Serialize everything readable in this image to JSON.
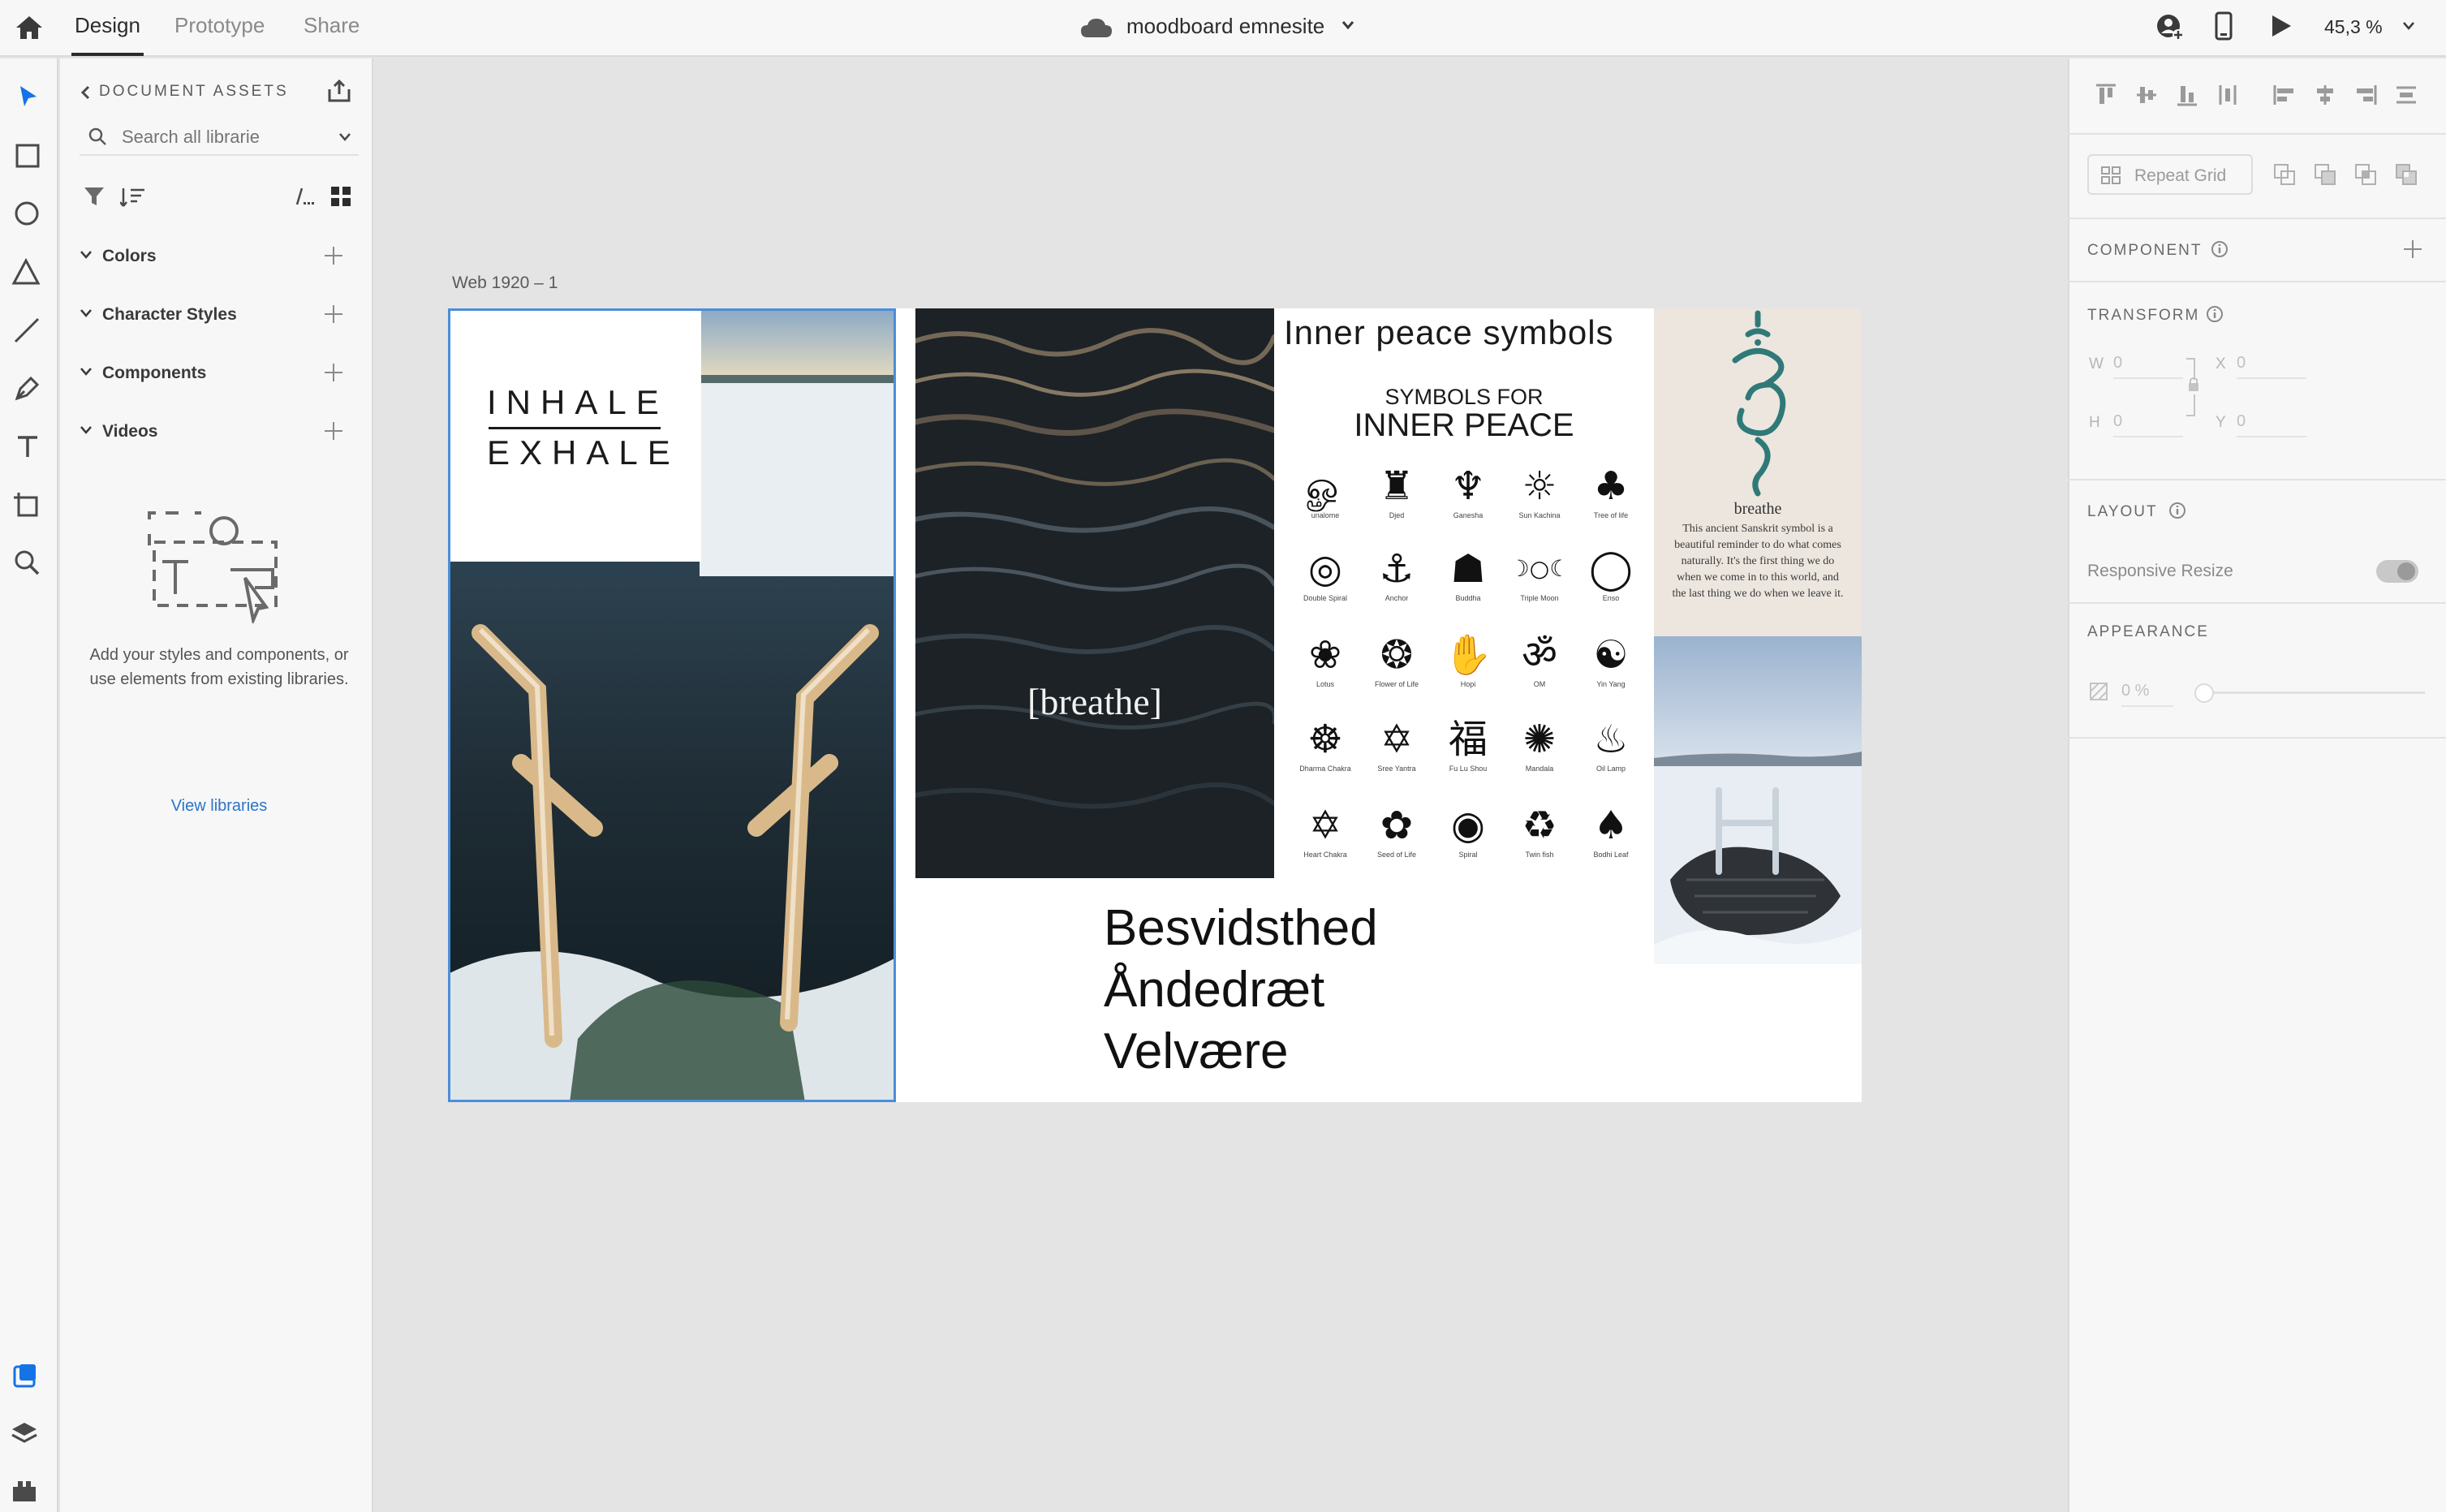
{
  "topbar": {
    "tabs": [
      "Design",
      "Prototype",
      "Share"
    ],
    "document_title": "moodboard emnesite",
    "zoom": "45,3 %"
  },
  "assets_panel": {
    "title": "DOCUMENT ASSETS",
    "search_placeholder": "Search all librarie",
    "sections": [
      "Colors",
      "Character Styles",
      "Components",
      "Videos"
    ],
    "empty_text": "Add your styles and components, or use elements from existing libraries.",
    "view_libraries": "View libraries"
  },
  "canvas": {
    "artboard_label": "Web 1920 – 1",
    "inhale": "INHALE",
    "exhale": "EXHALE",
    "breathe_caption": "[breathe]",
    "symbols_heading": "Inner peace symbols",
    "symbols_poster_line1": "SYMBOLS FOR",
    "symbols_poster_line2": "INNER PEACE",
    "symbols": [
      {
        "glyph": "ௐ",
        "name": "unalome"
      },
      {
        "glyph": "♜",
        "name": "Djed"
      },
      {
        "glyph": "♆",
        "name": "Ganesha"
      },
      {
        "glyph": "☼",
        "name": "Sun Kachina"
      },
      {
        "glyph": "♣",
        "name": "Tree of life"
      },
      {
        "glyph": "◎",
        "name": "Double Spiral"
      },
      {
        "glyph": "⚓",
        "name": "Anchor"
      },
      {
        "glyph": "☗",
        "name": "Buddha"
      },
      {
        "glyph": "☽○☾",
        "name": "Triple Moon"
      },
      {
        "glyph": "◯",
        "name": "Enso"
      },
      {
        "glyph": "❀",
        "name": "Lotus"
      },
      {
        "glyph": "❂",
        "name": "Flower of Life"
      },
      {
        "glyph": "✋",
        "name": "Hopi"
      },
      {
        "glyph": "ॐ",
        "name": "OM"
      },
      {
        "glyph": "☯",
        "name": "Yin Yang"
      },
      {
        "glyph": "☸",
        "name": "Dharma Chakra"
      },
      {
        "glyph": "✡",
        "name": "Sree Yantra"
      },
      {
        "glyph": "福",
        "name": "Fu Lu Shou"
      },
      {
        "glyph": "✺",
        "name": "Mandala"
      },
      {
        "glyph": "♨",
        "name": "Oil Lamp"
      },
      {
        "glyph": "✡",
        "name": "Heart Chakra"
      },
      {
        "glyph": "✿",
        "name": "Seed of Life"
      },
      {
        "glyph": "◉",
        "name": "Spiral"
      },
      {
        "glyph": "♻",
        "name": "Twin fish"
      },
      {
        "glyph": "♠",
        "name": "Bodhi Leaf"
      }
    ],
    "words": [
      "Besvidsthed",
      "Åndedræt",
      "Velvære"
    ],
    "sanskrit_title": "breathe",
    "sanskrit_text": "This ancient Sanskrit symbol is a beautiful reminder to do what comes naturally. It's the first thing we do when we come in to this world, and the last thing we do when we leave it."
  },
  "properties": {
    "repeat_grid": "Repeat Grid",
    "component": "COMPONENT",
    "transform": "TRANSFORM",
    "w_label": "W",
    "w_value": "0",
    "x_label": "X",
    "x_value": "0",
    "h_label": "H",
    "h_value": "0",
    "y_label": "Y",
    "y_value": "0",
    "layout": "LAYOUT",
    "responsive_resize": "Responsive Resize",
    "appearance": "APPEARANCE",
    "opacity": "0 %"
  },
  "colors": {
    "accent": "#1473e6",
    "link": "#2d73c8",
    "selection": "#4b8ed9",
    "teal_symbol": "#2f7a78"
  }
}
